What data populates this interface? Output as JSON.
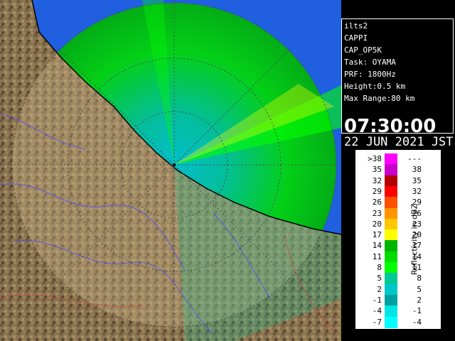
{
  "info": {
    "lines": [
      "ilts2",
      "CAPPI",
      "CAP_OP5K",
      "Task: OYAMA",
      "PRF: 1800Hz",
      "Height:0.5 km",
      "Max Range:80 km"
    ],
    "time": "07:30:00",
    "date": "22 JUN 2021 JST"
  },
  "legend": {
    "title": "Reflectivity in dBZ",
    "rows": [
      {
        "lo": ">38",
        "hi": "---",
        "color": "#ff00ff"
      },
      {
        "lo": "35",
        "hi": "38",
        "color": "#c800c8"
      },
      {
        "lo": "32",
        "hi": "35",
        "color": "#b40000"
      },
      {
        "lo": "29",
        "hi": "32",
        "color": "#ff0000"
      },
      {
        "lo": "26",
        "hi": "29",
        "color": "#ff5000"
      },
      {
        "lo": "23",
        "hi": "26",
        "color": "#ff9600"
      },
      {
        "lo": "20",
        "hi": "23",
        "color": "#ffc800"
      },
      {
        "lo": "17",
        "hi": "20",
        "color": "#ffff00"
      },
      {
        "lo": "14",
        "hi": "17",
        "color": "#00b400"
      },
      {
        "lo": "11",
        "hi": "14",
        "color": "#00dc00"
      },
      {
        "lo": "8",
        "hi": "11",
        "color": "#00ff00"
      },
      {
        "lo": "5",
        "hi": "8",
        "color": "#00c896"
      },
      {
        "lo": "2",
        "hi": "5",
        "color": "#00c8c8"
      },
      {
        "lo": "-1",
        "hi": "2",
        "color": "#00a0a0"
      },
      {
        "lo": "-4",
        "hi": "-1",
        "color": "#00e6e6"
      },
      {
        "lo": "-7",
        "hi": "-4",
        "color": "#00ffff"
      }
    ]
  },
  "map": {
    "sea_color": "#1f5fe0",
    "land_color": "#8a7350",
    "range_ring_color": "#4a4a4a"
  }
}
